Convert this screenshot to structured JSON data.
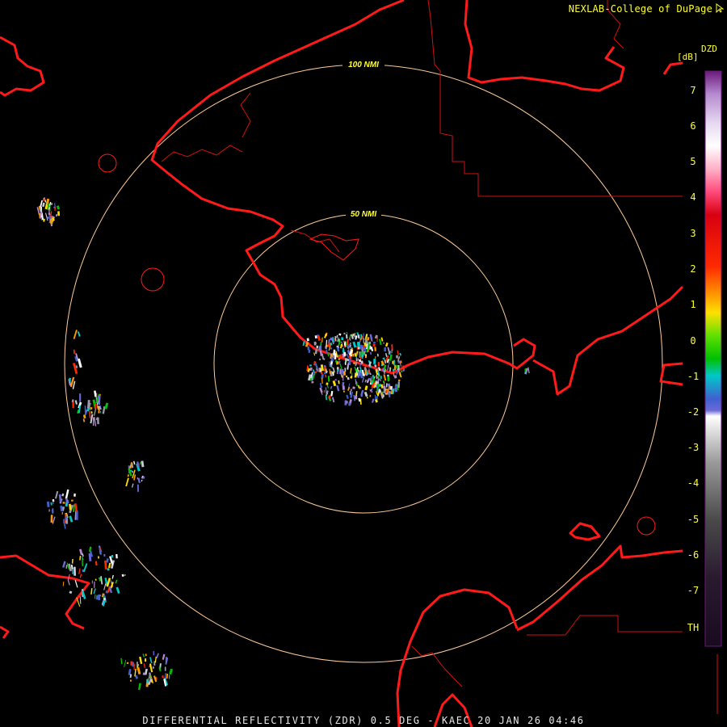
{
  "credit": "NEXLAB-College of DuPage",
  "colorbar": {
    "product": "DZD",
    "unit": "[dB]",
    "ticks": [
      "7",
      "6",
      "5",
      "4",
      "3",
      "2",
      "1",
      "0",
      "-1",
      "-2",
      "-3",
      "-4",
      "-5",
      "-6",
      "-7",
      "TH"
    ]
  },
  "rings": {
    "inner_label": "50 NMI",
    "outer_label": "100 NMI"
  },
  "footer": "DIFFERENTIAL REFLECTIVITY (ZDR) 0.5 DEG - KAEC 20 JAN 26 04:46",
  "colors": {
    "coastline": "#ff1a1a",
    "range_ring": "#ffcc99",
    "label_text": "#ffff33"
  }
}
